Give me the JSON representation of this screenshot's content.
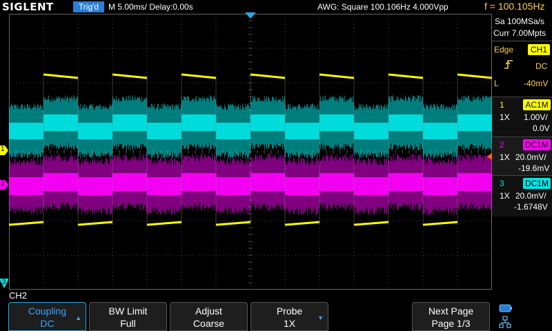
{
  "header": {
    "brand": "SIGLENT",
    "trigger_status": "Trig'd",
    "timebase": "M 5.00ms/ Delay:0.00s",
    "awg": "AWG: Square  100.106Hz  4.000Vpp",
    "frequency": "f = 100.105Hz"
  },
  "acquisition": {
    "sample_rate": "Sa 100MSa/s",
    "memory": "Curr 7.00Mpts"
  },
  "trigger": {
    "type": "Edge",
    "source": "CH1",
    "coupling": "DC",
    "level_label": "L",
    "level": "-40mV"
  },
  "channels": [
    {
      "num": "1",
      "badge": "AC1M",
      "probe": "1X",
      "scale": "1.00V/",
      "offset": "0.0V",
      "color": "#ffff00"
    },
    {
      "num": "2",
      "badge": "DC1M",
      "probe": "1X",
      "scale": "20.0mV/",
      "offset": "-19.6mV",
      "color": "#ff00ff"
    },
    {
      "num": "3",
      "badge": "DC1M",
      "probe": "1X",
      "scale": "20.0mV/",
      "offset": "-1.6748V",
      "color": "#00ffff"
    }
  ],
  "markers": {
    "ch1": "1",
    "ch2": "2",
    "ch3": "3"
  },
  "menu": {
    "title": "CH2",
    "softkeys": [
      {
        "line1": "Coupling",
        "line2": "DC"
      },
      {
        "line1": "BW Limit",
        "line2": "Full"
      },
      {
        "line1": "Adjust",
        "line2": "Coarse"
      },
      {
        "line1": "Probe",
        "line2": "1X"
      },
      {
        "line1": "Next Page",
        "line2": "Page 1/3"
      }
    ]
  },
  "colors": {
    "ch1": "#ffff00",
    "ch2": "#ff00ff",
    "ch3": "#00e5e5",
    "accent": "#2a7fd4",
    "grid": "#4a4a4a"
  },
  "waveforms": {
    "ch1": {
      "signal": "square",
      "frequency_hz": 100.106,
      "high_v": 2.0,
      "low_v": -2.0
    },
    "ch2": {
      "signal": "noise",
      "level": "DC"
    },
    "ch3": {
      "signal": "square"
    }
  }
}
